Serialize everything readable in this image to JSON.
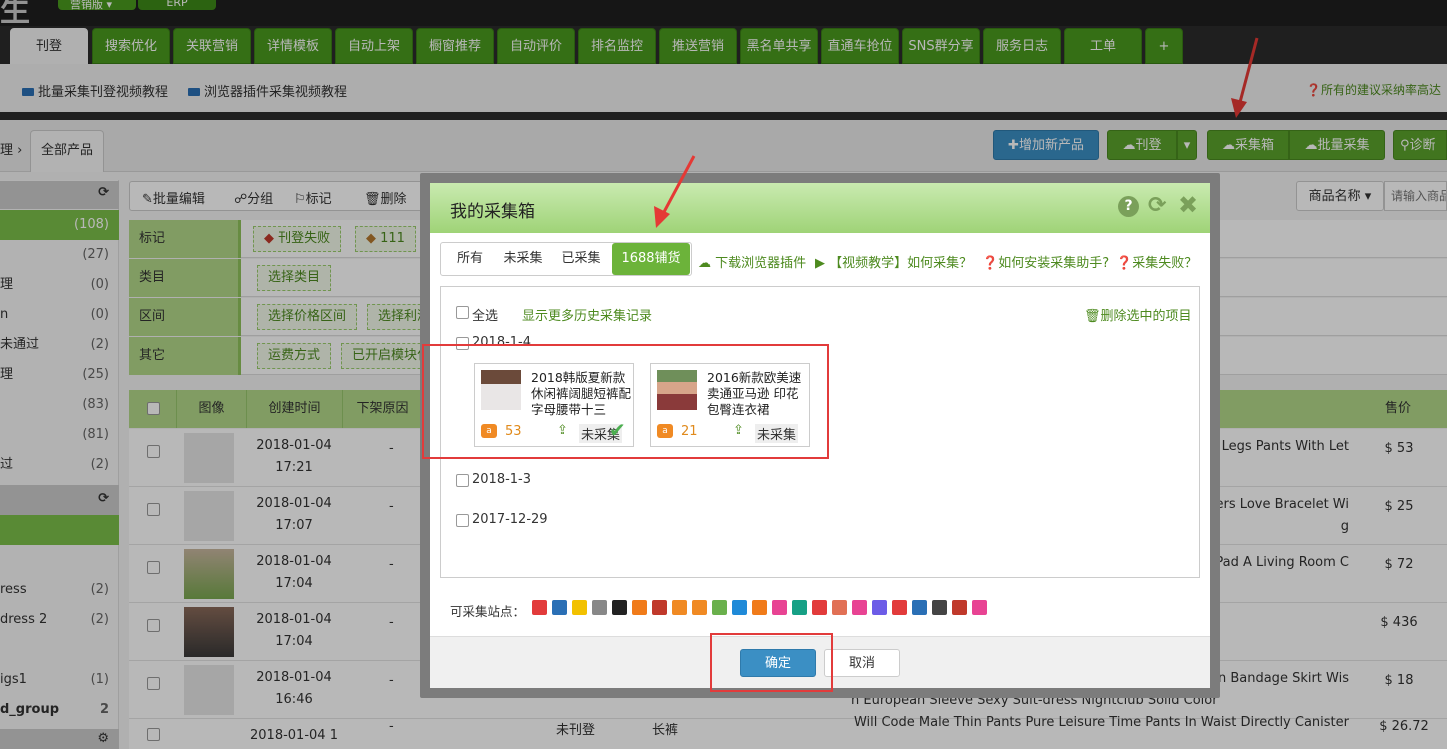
{
  "topbar": {
    "logo": "生",
    "pill1": "营销版 ▾",
    "pill2": "ERP"
  },
  "nav": {
    "tabs": [
      "刊登",
      "搜索优化",
      "关联营销",
      "详情模板",
      "自动上架",
      "橱窗推荐",
      "自动评价",
      "排名监控",
      "推送营销",
      "黑名单共享",
      "直通车抢位",
      "SNS群分享",
      "服务日志",
      "工单",
      "+"
    ]
  },
  "helpbar": {
    "link1": "批量采集刊登视频教程",
    "link2": "浏览器插件采集视频教程",
    "right_note": "所有的建议采纳率高达"
  },
  "crumb": {
    "arrow": "理 ›",
    "tab": "全部产品"
  },
  "toolbar": {
    "add_product": "增加新产品",
    "publish": "刊登",
    "collect_box": "采集箱",
    "batch_collect": "批量采集",
    "diagnose": "诊断"
  },
  "actions": {
    "batch_edit": "批量编辑",
    "group": "分组",
    "mark": "标记",
    "delete": "删除",
    "sort_by": "商品名称 ▾",
    "search_placeholder": "请输入商品"
  },
  "sidebar": {
    "rows": [
      {
        "label": "",
        "count": "(108)"
      },
      {
        "label": "",
        "count": "(27)"
      },
      {
        "label": "理",
        "count": "(0)"
      },
      {
        "label": "n",
        "count": "(0)"
      },
      {
        "label": "未通过",
        "count": "(2)"
      },
      {
        "label": "理",
        "count": "(25)"
      },
      {
        "label": "",
        "count": "(83)"
      },
      {
        "label": "",
        "count": "(81)"
      },
      {
        "label": "过",
        "count": "(2)"
      }
    ],
    "group_rows": [
      {
        "label": "ress",
        "count": "(2)"
      },
      {
        "label": "dress 2",
        "count": "(2)"
      },
      {
        "label": "igs1",
        "count": "(1)"
      },
      {
        "label": "d_group",
        "count": "2"
      }
    ]
  },
  "filters": {
    "mark_label": "标记",
    "mark_tag1": "刊登失败",
    "mark_tag2": "111",
    "category_label": "类目",
    "category_tag": "选择类目",
    "range_label": "区间",
    "range_tag1": "选择价格区间",
    "range_tag2": "选择利润",
    "other_label": "其它",
    "other_tag1": "运费方式",
    "other_tag2": "已开启模块化"
  },
  "grid": {
    "headers": {
      "image": "图像",
      "created": "创建时间",
      "reason": "下架原因",
      "price": "售价"
    },
    "rows": [
      {
        "time": "2018-01-04 17:21",
        "dash": "-",
        "title": "t Legs Pants With Let",
        "price": "$ 53"
      },
      {
        "time": "2018-01-04 17:07",
        "dash": "-",
        "title": "vers Love Bracelet Wi",
        "title2": "g",
        "price": "$ 25"
      },
      {
        "time": "2018-01-04 17:04",
        "dash": "-",
        "title": "Pad A Living Room C",
        "price": "$ 72"
      },
      {
        "time": "2018-01-04 17:04",
        "dash": "-",
        "title": "",
        "price": "$ 436"
      },
      {
        "time": "2018-01-04 16:46",
        "dash": "-",
        "title": "ion Bandage Skirt Wis",
        "title2": "h European Sleeve Sexy Suit-dress Nightclub Solid Color",
        "price": "$ 18"
      },
      {
        "time": "2018-01-04 1",
        "dash": "-",
        "status": "未刊登",
        "cat": "长裤",
        "title": "Will Code Male Thin Pants Pure Leisure Time Pants In Waist Directly Canister",
        "price": "$ 26.72"
      }
    ]
  },
  "modal": {
    "title": "我的采集箱",
    "tabs": [
      "所有",
      "未采集",
      "已采集",
      "1688铺货"
    ],
    "links": {
      "plugin": "下载浏览器插件",
      "video": "【视频教学】如何采集？",
      "install": "如何安装采集助手?",
      "fail": "采集失败？"
    },
    "select_all": "全选",
    "more_history": "显示更多历史采集记录",
    "delete_selected": "删除选中的项目",
    "dates": [
      "2018-1-4",
      "2018-1-3",
      "2017-12-29"
    ],
    "cards": [
      {
        "title": "2018韩版夏新款休闲裤阔腿短裤配字母腰带十三",
        "count": "53",
        "status": "未采集"
      },
      {
        "title": "2016新款欧美速卖通亚马逊 印花包臀连衣裙",
        "count": "21",
        "status": "未采集"
      }
    ],
    "sites_label": "可采集站点：",
    "ok": "确定",
    "cancel": "取消"
  },
  "colors": {
    "brand_green": "#5aa32b",
    "blue": "#3b8fc4",
    "annotation_red": "#e53935"
  }
}
